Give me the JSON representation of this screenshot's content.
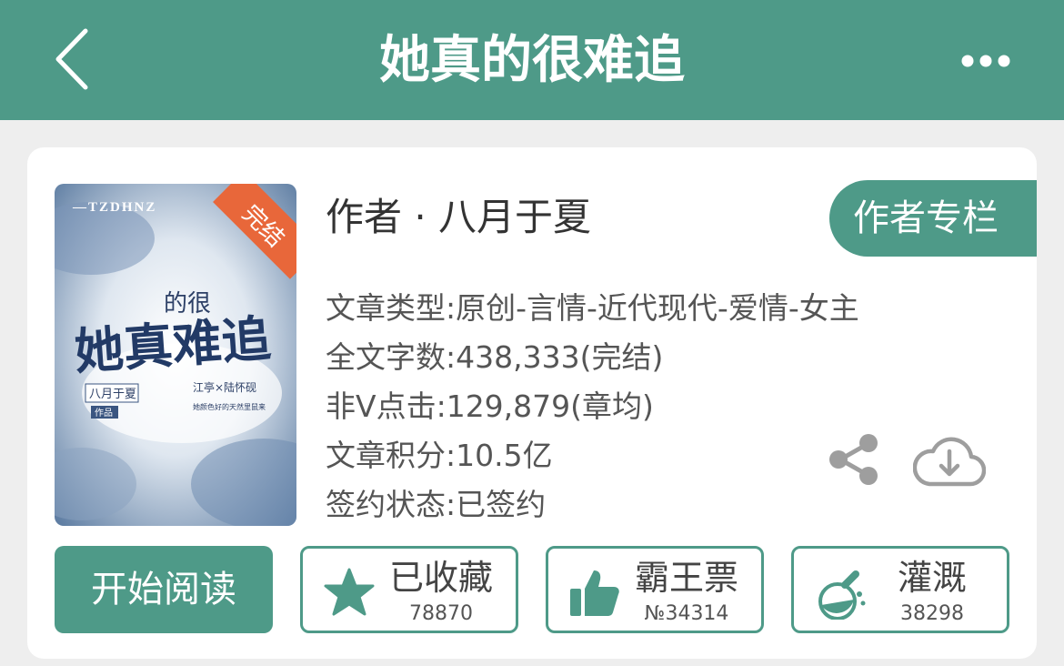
{
  "nav": {
    "title": "她真的很难追"
  },
  "book": {
    "cover": {
      "brand": "—TZDHNZ",
      "ribbon": "完结",
      "small_title": "的很",
      "big_title": "她真难追",
      "author_tag": "八月于夏",
      "author_sub": "作品",
      "couple": "江亭×陆怀砚",
      "tagline": "她颜色好的天然里鼠来"
    },
    "author": "作者 · 八月于夏",
    "author_column_label": "作者专栏",
    "info": [
      "文章类型:原创-言情-近代现代-爱情-女主",
      "全文字数:438,333(完结)",
      "非V点击:129,879(章均)",
      "文章积分:10.5亿",
      "签约状态:已签约"
    ]
  },
  "actions": {
    "read": "开始阅读",
    "favorite": {
      "label": "已收藏",
      "count": "78870"
    },
    "vote": {
      "label": "霸王票",
      "count": "№34314"
    },
    "water": {
      "label": "灌溉",
      "count": "38298"
    }
  },
  "colors": {
    "accent": "#4e9a88",
    "background": "#eeeeee",
    "ribbon": "#e8673a"
  },
  "icons": [
    "back-arrow-icon",
    "more-dots-icon",
    "share-icon",
    "cloud-download-icon",
    "star-icon",
    "thumbs-up-icon",
    "flask-icon"
  ]
}
